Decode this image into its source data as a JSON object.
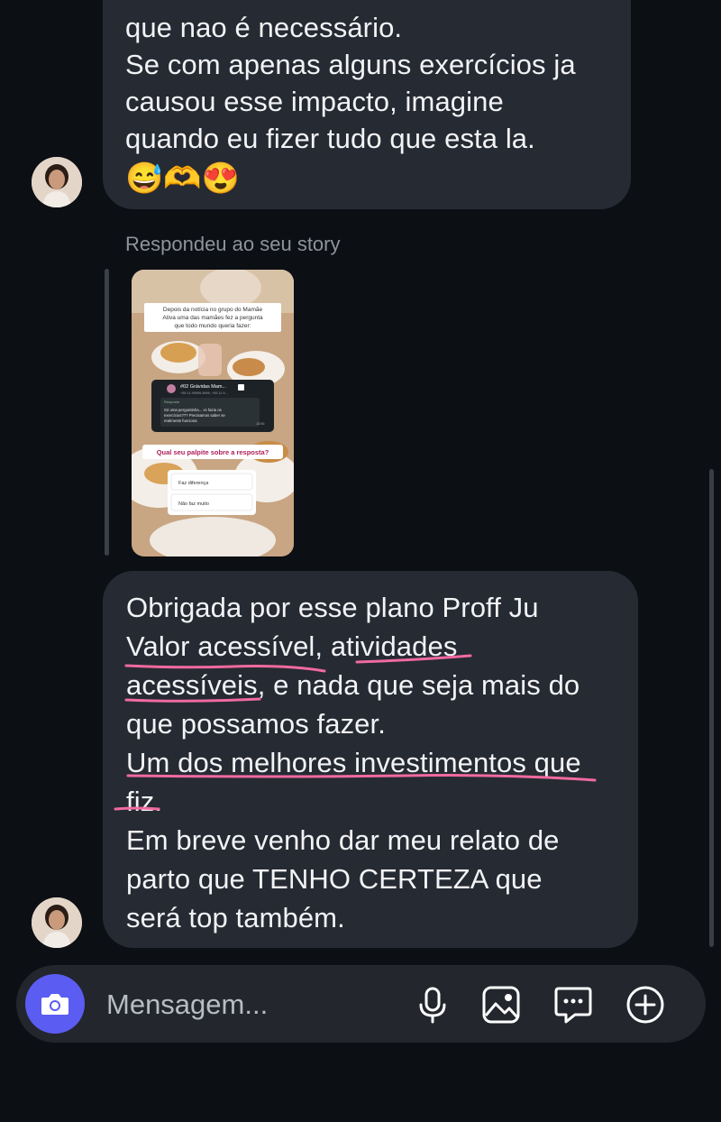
{
  "thread": {
    "first_message": {
      "lines": [
        "que nao é necessário.",
        "Se com apenas alguns exercícios ja",
        "causou esse impacto, imagine",
        "quando eu fizer tudo que esta la."
      ],
      "emojis": "😅🫶😍"
    },
    "story_reply": {
      "caption": "Respondeu ao seu story",
      "story": {
        "header": [
          "Depois da notícia no grupo do Mamãe",
          "Ativa uma das mamães fez a pergunta",
          "que todo mundo queria fazer:"
        ],
        "chat_title": "#02 Grávidas Mam...",
        "chat_subtitle": "+55 11 99999-9999, +55 11 9...",
        "chat_sender": "Resposta",
        "chat_text": [
          "Só uma perguntinha... vc fazia os",
          "exercícios??? Precisamos saber se",
          "realmente funciona"
        ],
        "chat_time": "15:56",
        "question": "Qual seu palpite sobre a resposta?",
        "options": [
          "Faz diferença",
          "Não faz muito"
        ]
      }
    },
    "second_message": {
      "line1": "Obrigada por esse plano Proff Ju",
      "line2a": "Valor acessível",
      "line2b": ", ",
      "line2c": "atividades",
      "line3a": "acessíveis",
      "line3b": ", e nada que seja mais do",
      "line4": "que possamos fazer.",
      "line5": "Um dos melhores investimentos que",
      "line6a": "fiz",
      "line6b": ".",
      "line7": "Em breve venho dar meu relato de",
      "line8": "parto que TENHO CERTEZA que",
      "line9": "será top também."
    }
  },
  "composer": {
    "placeholder": "Mensagem...",
    "icons": [
      "camera-icon",
      "microphone-icon",
      "image-icon",
      "sticker-icon",
      "add-icon"
    ]
  },
  "colors": {
    "background": "#0c0f14",
    "bubble": "#262a33",
    "accent": "#5b5cf2",
    "underline": "#f06aa0"
  }
}
